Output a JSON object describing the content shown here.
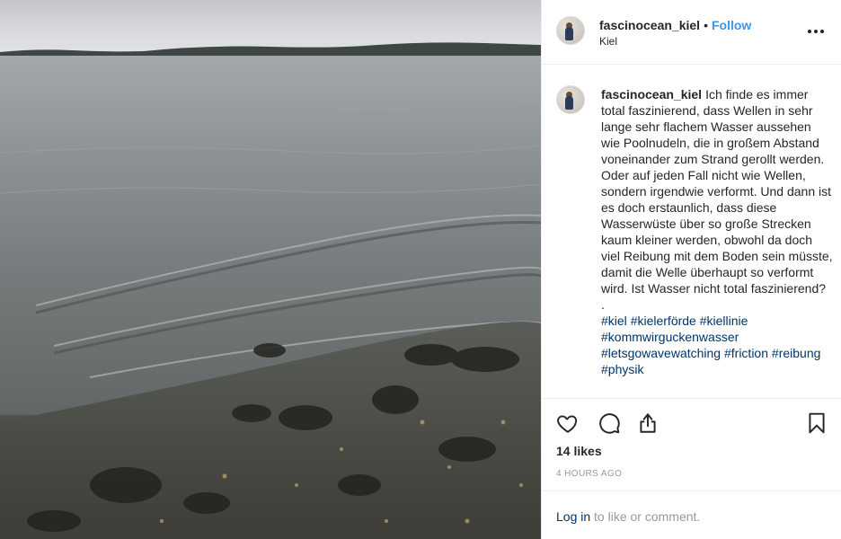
{
  "post": {
    "username": "fascinocean_kiel",
    "separator": "•",
    "follow_label": "Follow",
    "location": "Kiel",
    "caption_text": "Ich finde es immer total faszinierend, dass Wellen in sehr lange sehr flachem Wasser aussehen wie Poolnudeln, die in großem Abstand voneinander zum Strand gerollt werden. Oder auf jeden Fall nicht wie Wellen, sondern irgendwie verformt. Und dann ist es doch erstaunlich, dass diese Wasserwüste über so große Strecken kaum kleiner werden, obwohl da doch viel Reibung mit dem Boden sein müsste, damit die Welle überhaupt so verformt wird. Ist Wasser nicht total faszinierend?",
    "caption_dot": ".",
    "hashtags": [
      "#kiel",
      "#kielerförde",
      "#kiellinie",
      "#kommwirguckenwasser",
      "#letsgowavewatching",
      "#friction",
      "#reibung",
      "#physik"
    ],
    "likes": "14 likes",
    "time_ago": "4 HOURS AGO",
    "login_link": "Log in",
    "login_suffix": " to like or comment."
  },
  "icons": {
    "more": "more-options-icon",
    "like": "heart-icon",
    "comment": "comment-icon",
    "share": "share-icon",
    "save": "bookmark-icon"
  },
  "colors": {
    "link_blue": "#3897f0",
    "hashtag": "#003569",
    "muted": "#999999",
    "text": "#262626",
    "border": "#efefef"
  }
}
